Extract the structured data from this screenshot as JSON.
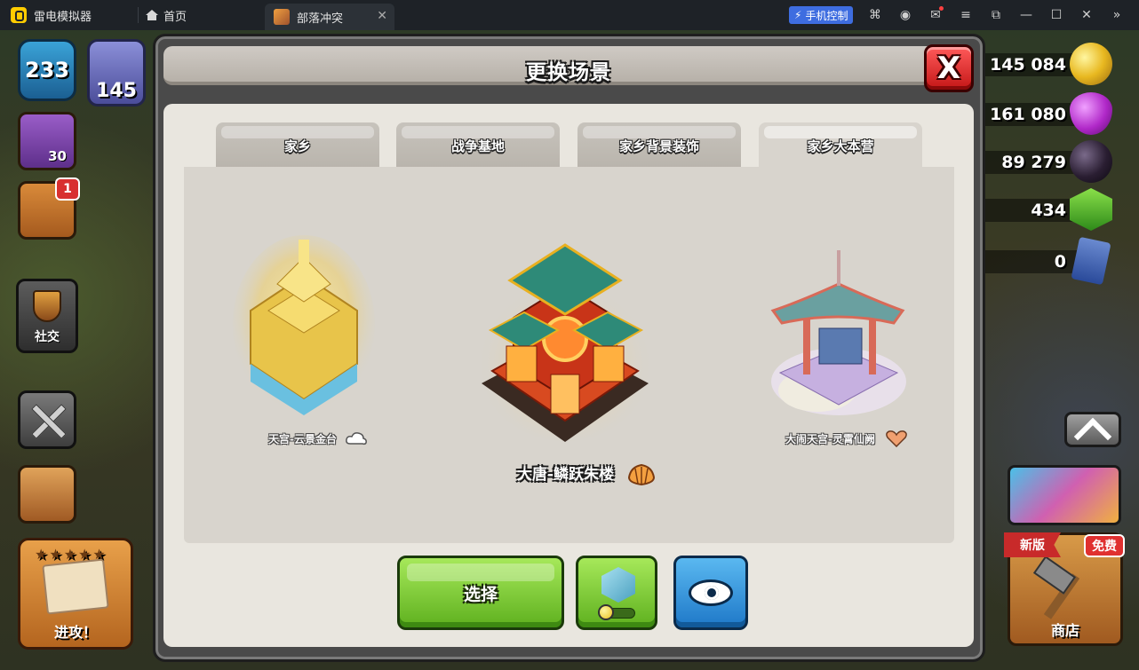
{
  "emulator": {
    "app_name": "雷电模拟器",
    "home_tab": "首页",
    "game_tab": "部落冲突",
    "phone_control": "手机控制"
  },
  "hud": {
    "level": "233",
    "trophies": "145",
    "builder_count": "30",
    "quest_badge": "1",
    "social_label": "社交",
    "attack_label": "进攻！",
    "resources": {
      "gold": "145 084",
      "elixir": "161 080",
      "dark_elixir": "89 279",
      "gems": "434",
      "tickets": "0"
    },
    "shop_label": "商店",
    "new_tag": "新版",
    "free_tag": "免费"
  },
  "modal": {
    "title": "更换场景",
    "close_label": "X",
    "tabs": [
      {
        "label": "家乡"
      },
      {
        "label": "战争基地"
      },
      {
        "label": "家乡背景装饰"
      },
      {
        "label": "家乡大本营"
      }
    ],
    "active_tab": 3,
    "scenes": [
      {
        "name": "天宫-云景金台",
        "currency_icon": "cloud-icon"
      },
      {
        "name": "大唐-鳞跃朱楼",
        "currency_icon": "shell-icon"
      },
      {
        "name": "大闹天宫-灵霄仙阙",
        "currency_icon": "heart-icon"
      }
    ],
    "select_label": "选择"
  },
  "colors": {
    "accent_green": "#5eb01e",
    "accent_blue": "#1e78c8",
    "close_red": "#c41616"
  }
}
